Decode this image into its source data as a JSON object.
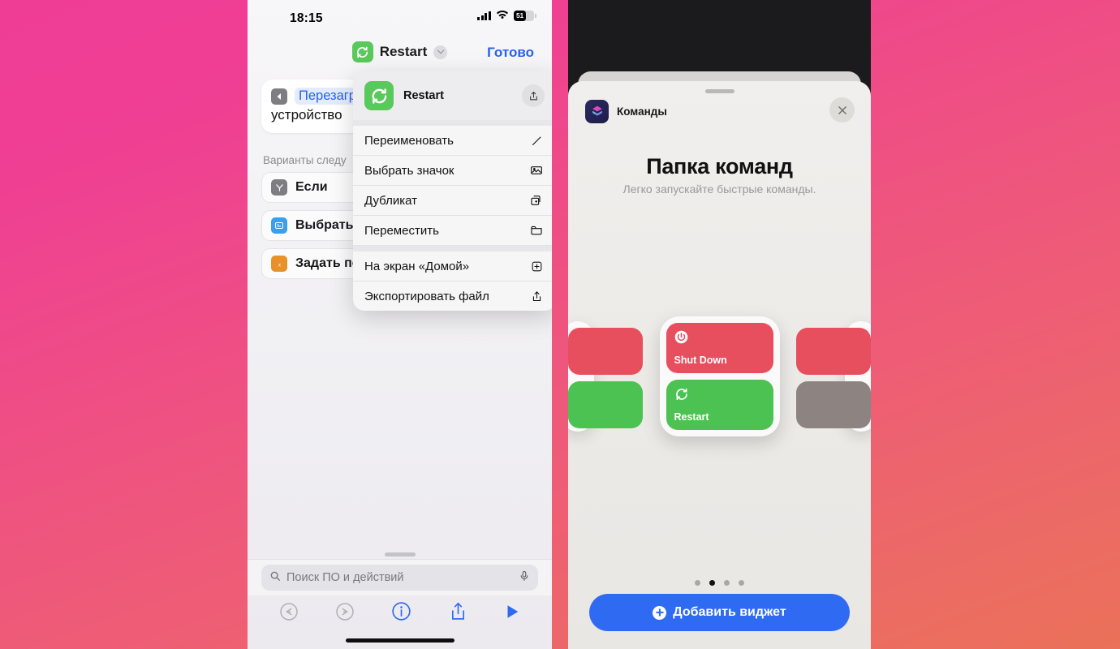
{
  "left_phone": {
    "status_bar": {
      "time": "18:15",
      "battery_percent": "51",
      "cellular_icon": "cellular-bars-icon",
      "wifi_icon": "wifi-icon",
      "battery_icon": "battery-icon"
    },
    "nav_bar": {
      "icon": "restart-shortcut-icon",
      "title": "Restart",
      "chevron_icon": "chevron-down-icon",
      "done_label": "Готово"
    },
    "action_card": {
      "back_icon": "shortcut-back-icon",
      "token": "Перезагрузить",
      "text": "устройство"
    },
    "section_label": "Варианты следу",
    "suggestions": [
      {
        "icon": "if-icon",
        "label": "Если"
      },
      {
        "icon": "choose-from-menu-icon",
        "label": "Выбрать из"
      },
      {
        "icon": "set-variable-icon",
        "label": "Задать пер"
      }
    ],
    "context_menu": {
      "header": {
        "icon": "restart-shortcut-icon",
        "title": "Restart",
        "share_icon": "share-icon"
      },
      "items": [
        {
          "label": "Переименовать",
          "icon": "pencil-icon"
        },
        {
          "label": "Выбрать значок",
          "icon": "photo-icon"
        },
        {
          "label": "Дубликат",
          "icon": "duplicate-icon"
        },
        {
          "label": "Переместить",
          "icon": "folder-icon"
        },
        {
          "label": "На экран «Домой»",
          "icon": "add-to-home-icon"
        },
        {
          "label": "Экспортировать файл",
          "icon": "share-up-icon"
        }
      ]
    },
    "search": {
      "placeholder": "Поиск ПО и действий",
      "search_icon": "search-icon",
      "mic_icon": "microphone-icon"
    },
    "toolbar": [
      {
        "name": "undo",
        "icon": "undo-icon"
      },
      {
        "name": "redo",
        "icon": "redo-icon"
      },
      {
        "name": "info",
        "icon": "info-icon"
      },
      {
        "name": "share",
        "icon": "share-icon"
      },
      {
        "name": "play",
        "icon": "play-icon"
      }
    ]
  },
  "right_phone": {
    "sheet": {
      "app_icon": "shortcuts-app-icon",
      "app_name": "Команды",
      "close_icon": "close-icon",
      "title": "Папка команд",
      "subtitle": "Легко запускайте быстрые команды."
    },
    "widget": {
      "buttons": [
        {
          "label": "Shut Down",
          "icon": "power-icon",
          "color": "#e84f5e"
        },
        {
          "label": "Restart",
          "icon": "restart-icon",
          "color": "#4cc253"
        }
      ]
    },
    "page_dots": {
      "count": 4,
      "active_index": 1
    },
    "add_button": {
      "label": "Добавить виджет",
      "icon": "plus-circle-icon"
    }
  },
  "colors": {
    "accent_blue": "#2f6bf2",
    "green": "#58c95a",
    "red": "#e84f5e",
    "bg_gradient_start": "#ef3d96",
    "bg_gradient_end": "#eb7159"
  }
}
